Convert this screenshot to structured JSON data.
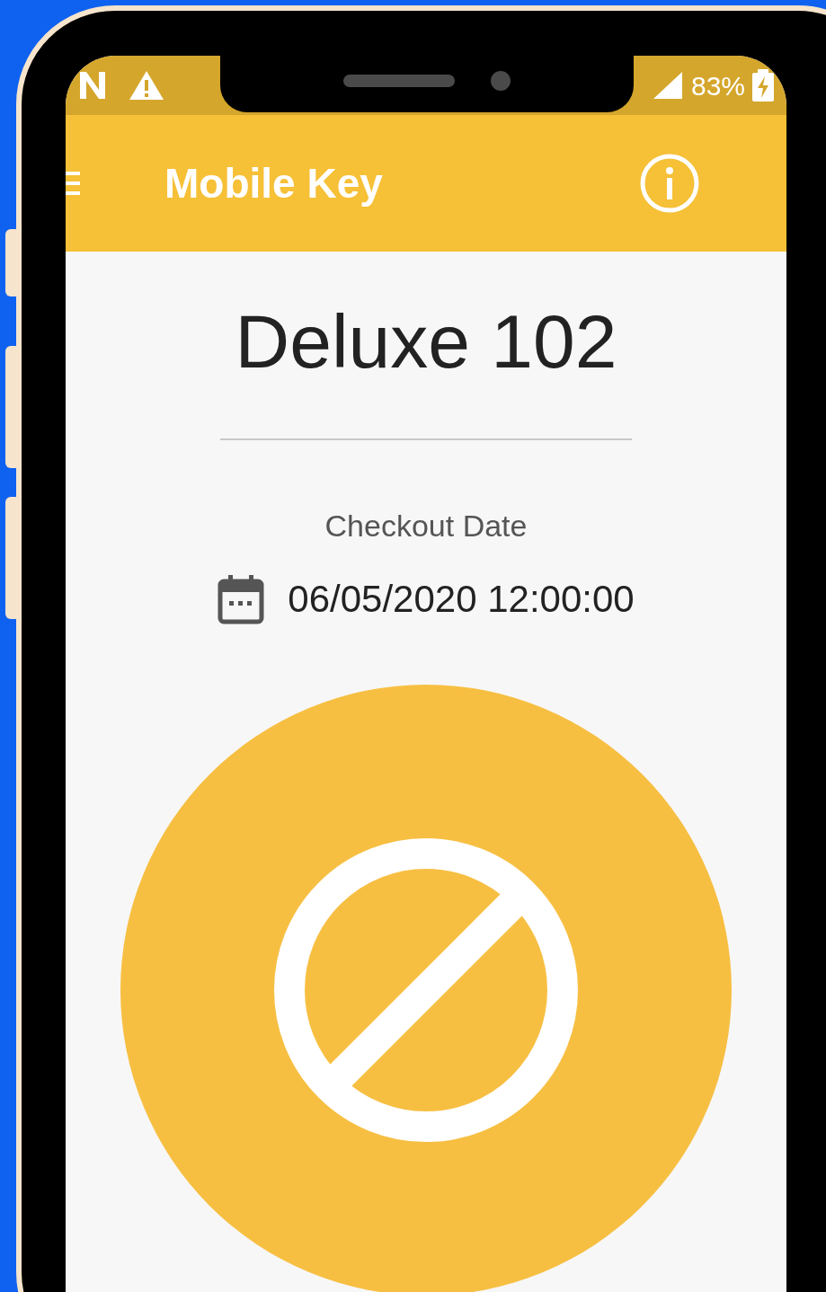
{
  "status_bar": {
    "battery": "83%"
  },
  "app_bar": {
    "title": "Mobile Key"
  },
  "room": {
    "name": "Deluxe 102"
  },
  "checkout": {
    "label": "Checkout Date",
    "value": "06/05/2020 12:00:00"
  }
}
